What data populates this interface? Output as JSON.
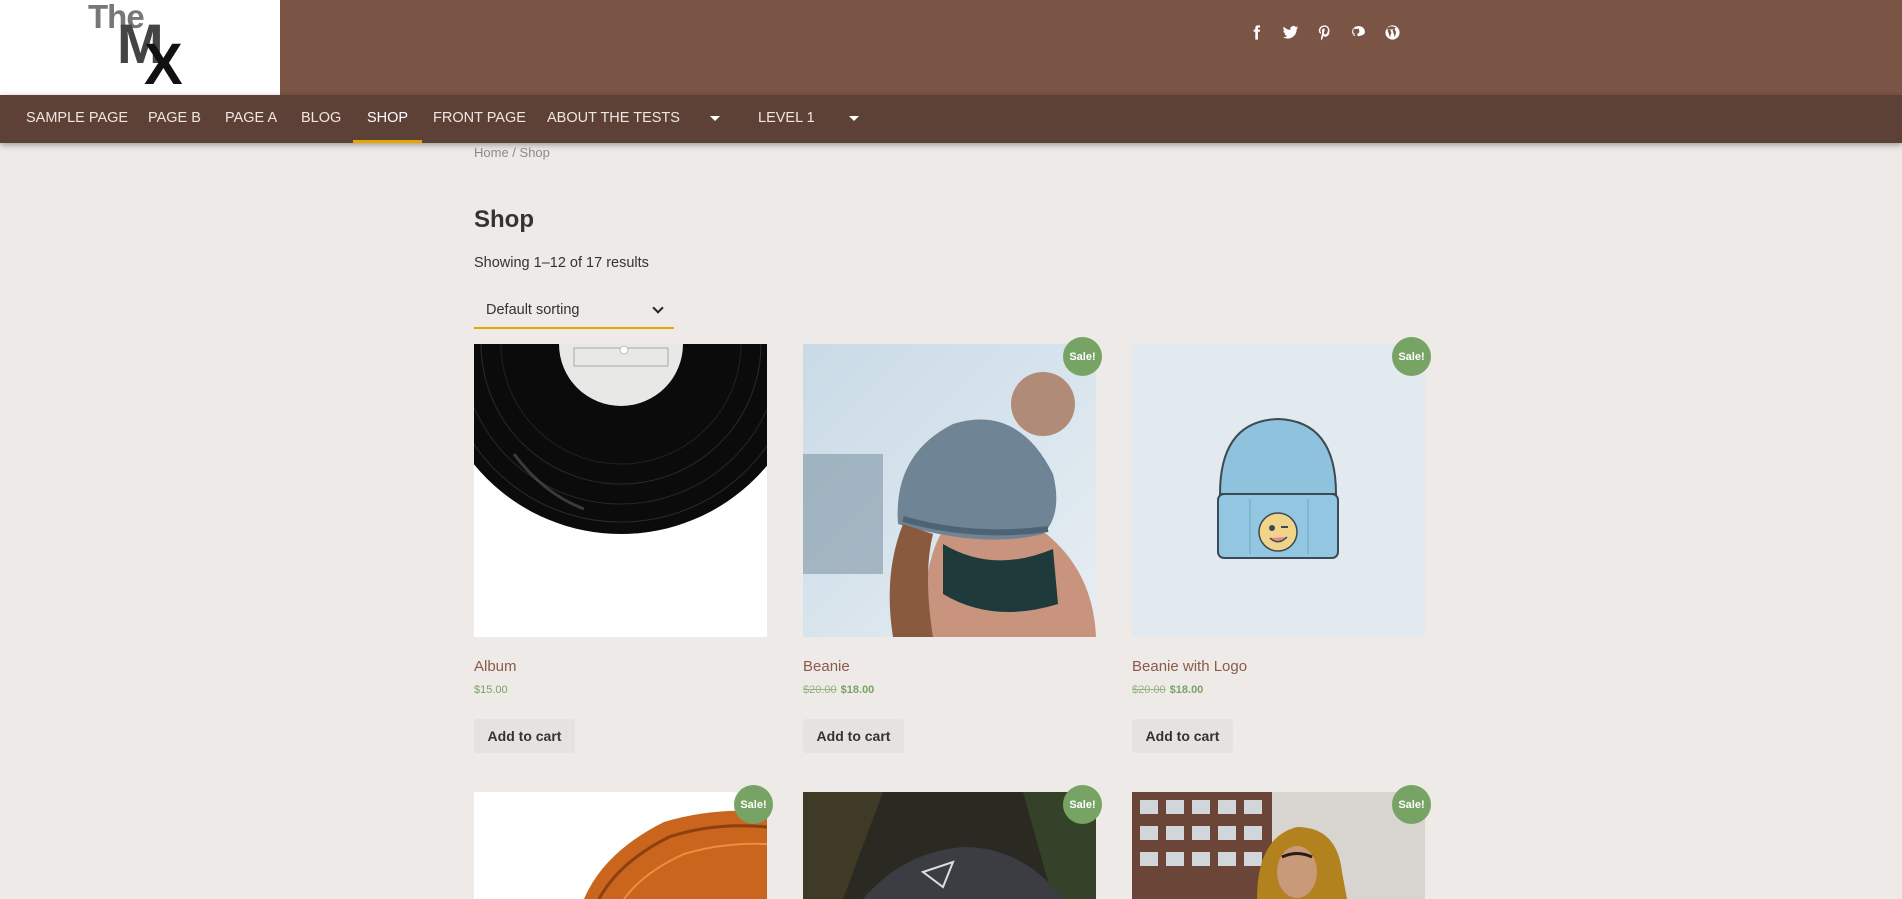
{
  "header": {
    "logo": {
      "the": "The",
      "m": "M",
      "x": "X"
    },
    "social": [
      {
        "icon": "facebook-icon",
        "glyph": "f"
      },
      {
        "icon": "twitter-icon",
        "glyph": "t"
      },
      {
        "icon": "pinterest-icon",
        "glyph": "p"
      },
      {
        "icon": "github-icon",
        "glyph": "g"
      },
      {
        "icon": "wordpress-icon",
        "glyph": "W"
      }
    ]
  },
  "nav": {
    "items": [
      "SAMPLE PAGE",
      "PAGE B",
      "PAGE A",
      "BLOG",
      "SHOP",
      "FRONT PAGE",
      "ABOUT THE TESTS",
      "LEVEL 1"
    ],
    "active": "SHOP"
  },
  "breadcrumb": {
    "home": "Home",
    "sep": " / ",
    "current": "Shop"
  },
  "page": {
    "title": "Shop",
    "result_count": "Showing 1–12 of 17 results",
    "sort_value": "Default sorting"
  },
  "products": [
    {
      "name": "Album",
      "price": "$15.00",
      "button": "Add to cart"
    },
    {
      "name": "Beanie",
      "old_price": "$20.00",
      "price": "$18.00",
      "sale": "Sale!",
      "button": "Add to cart"
    },
    {
      "name": "Beanie with Logo",
      "old_price": "$20.00",
      "price": "$18.00",
      "sale": "Sale!",
      "button": "Add to cart"
    },
    {
      "sale": "Sale!"
    },
    {
      "sale": "Sale!"
    },
    {
      "sale": "Sale!"
    }
  ],
  "colors": {
    "header_bg": "#7a5546",
    "nav_bg": "#5d4137",
    "accent": "#e8a400",
    "sale_badge": "#77a464",
    "page_bg": "#eeeae7"
  }
}
